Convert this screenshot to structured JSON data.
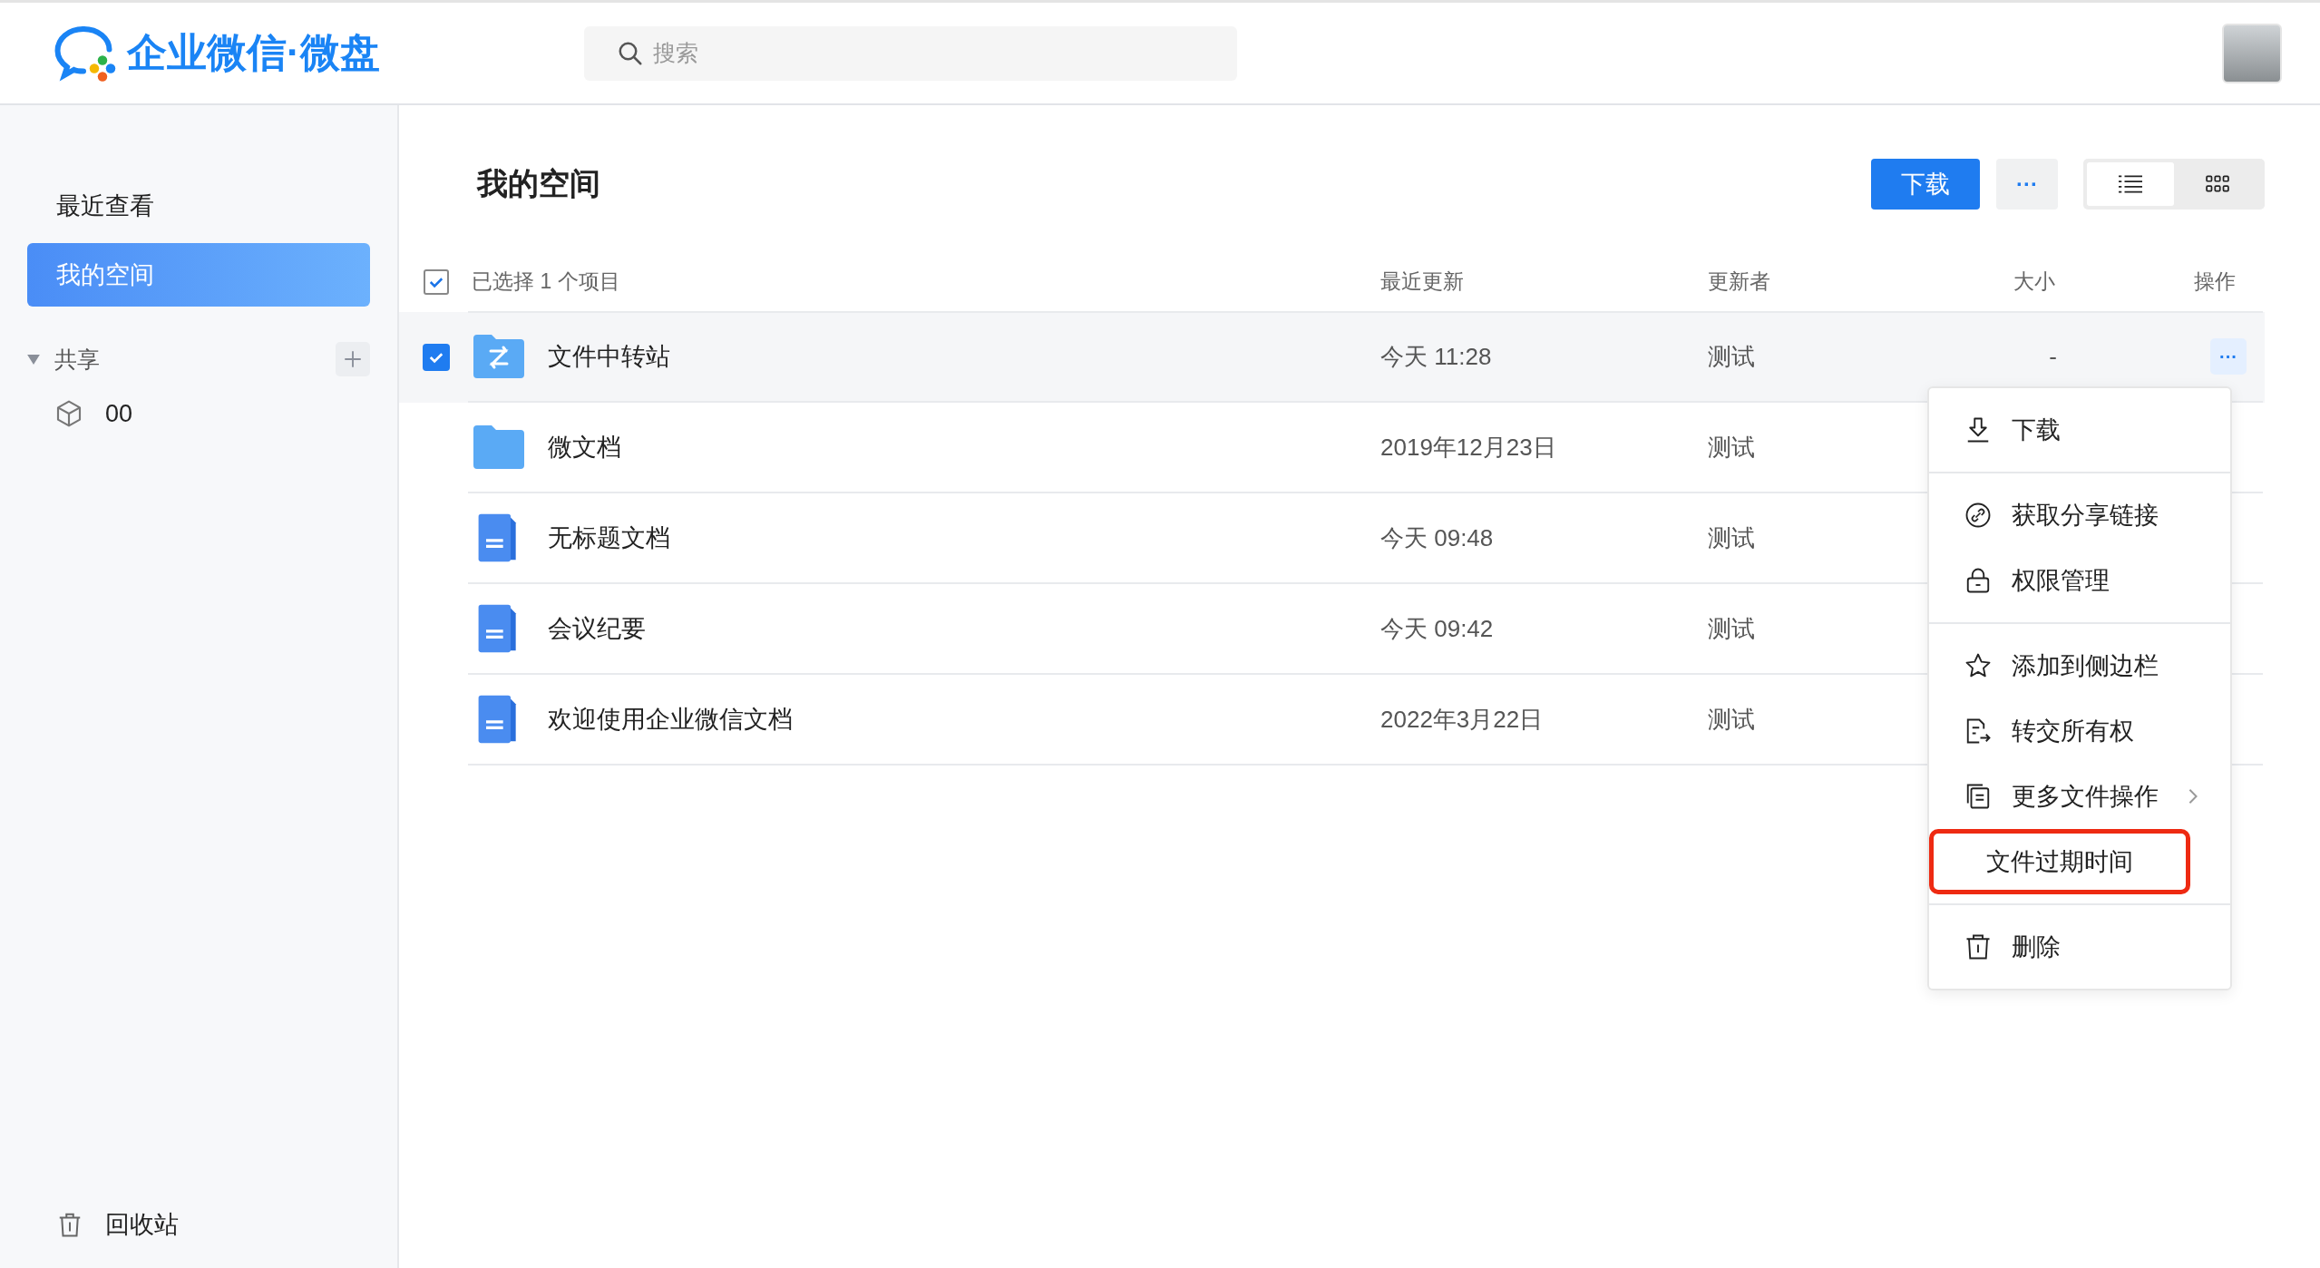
{
  "header": {
    "logo_text": "企业微信·微盘",
    "search": {
      "placeholder": "搜索"
    }
  },
  "sidebar": {
    "nav": [
      {
        "label": "最近查看",
        "selected": false
      },
      {
        "label": "我的空间",
        "selected": true
      }
    ],
    "shared": {
      "label": "共享",
      "expanded": true,
      "children": [
        {
          "label": "00"
        }
      ]
    },
    "trash": {
      "label": "回收站"
    }
  },
  "main": {
    "title": "我的空间",
    "toolbar": {
      "download": "下载",
      "more": "···",
      "views": [
        {
          "selected": true
        },
        {
          "selected": false
        }
      ]
    },
    "table": {
      "select_all_checked": true,
      "selection_label": "已选择 1 个项目",
      "columns": [
        "最近更新",
        "更新者",
        "大小",
        "操作"
      ],
      "rows": [
        {
          "kind": "transfer-folder",
          "name": "文件中转站",
          "updated": "今天 11:28",
          "updater": "测试",
          "size": "-",
          "action": "···",
          "selected": true
        },
        {
          "kind": "folder",
          "name": "微文档",
          "updated": "2019年12月23日",
          "updater": "测试",
          "selected": false
        },
        {
          "kind": "doc",
          "name": "无标题文档",
          "updated": "今天 09:48",
          "updater": "测试",
          "selected": false
        },
        {
          "kind": "doc",
          "name": "会议纪要",
          "updated": "今天 09:42",
          "updater": "测试",
          "selected": false
        },
        {
          "kind": "doc",
          "name": "欢迎使用企业微信文档",
          "updated": "2022年3月22日",
          "updater": "测试",
          "selected": false
        }
      ]
    }
  },
  "context_menu": {
    "groups": [
      [
        {
          "label": "下载",
          "submenu": false,
          "highlighted": false
        }
      ],
      [
        {
          "label": "获取分享链接",
          "submenu": false,
          "highlighted": false
        },
        {
          "label": "权限管理",
          "submenu": false,
          "highlighted": false
        }
      ],
      [
        {
          "label": "添加到侧边栏",
          "submenu": false,
          "highlighted": false
        },
        {
          "label": "转交所有权",
          "submenu": false,
          "highlighted": false
        },
        {
          "label": "更多文件操作",
          "submenu": true,
          "highlighted": false
        },
        {
          "label": "文件过期时间",
          "submenu": false,
          "highlighted": true
        }
      ],
      [
        {
          "label": "删除",
          "submenu": false,
          "highlighted": false
        }
      ]
    ]
  }
}
